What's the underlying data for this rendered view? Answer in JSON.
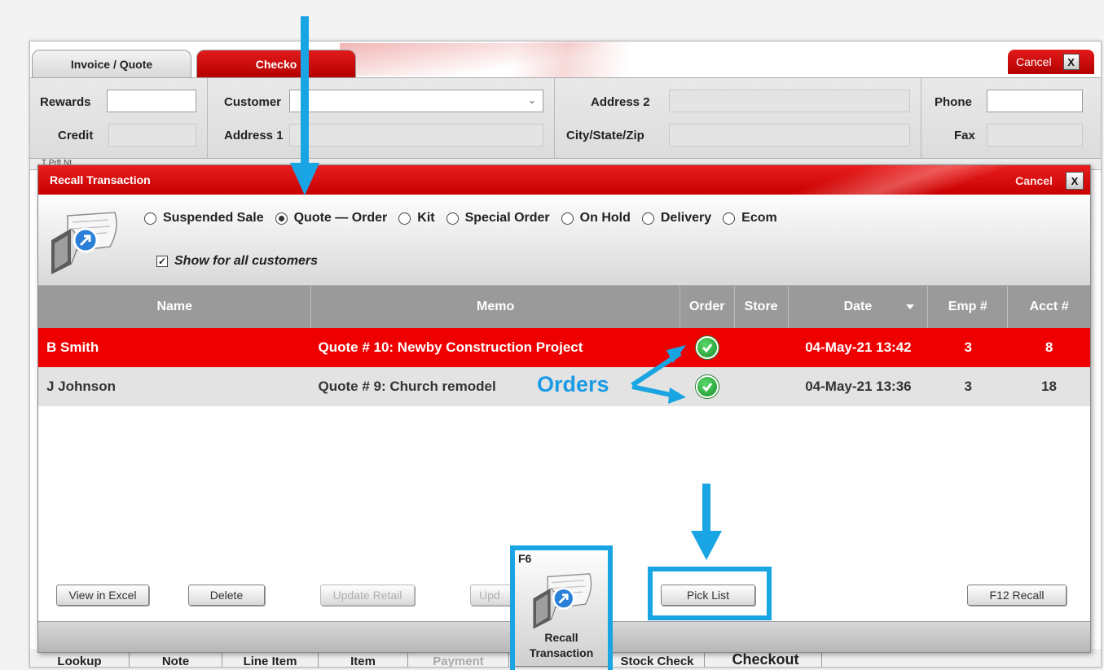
{
  "tabs": {
    "invoice_quote": "Invoice / Quote",
    "checkout": "Checko"
  },
  "window": {
    "cancel_label": "Cancel",
    "close_symbol": "X"
  },
  "header": {
    "rewards_label": "Rewards",
    "credit_label": "Credit",
    "customer_label": "Customer",
    "address1_label": "Address 1",
    "address2_label": "Address 2",
    "city_state_zip_label": "City/State/Zip",
    "phone_label": "Phone",
    "fax_label": "Fax",
    "under_strip_text": "T    Prft Nt"
  },
  "dialog": {
    "title": "Recall Transaction",
    "cancel_label": "Cancel",
    "close_symbol": "X",
    "radio_options": [
      {
        "label": "Suspended Sale",
        "selected": false
      },
      {
        "label": "Quote — Order",
        "selected": true
      },
      {
        "label": "Kit",
        "selected": false
      },
      {
        "label": "Special Order",
        "selected": false
      },
      {
        "label": "On Hold",
        "selected": false
      },
      {
        "label": "Delivery",
        "selected": false
      },
      {
        "label": "Ecom",
        "selected": false
      }
    ],
    "show_all_label": "Show for all customers",
    "show_all_checked": true,
    "columns": [
      "Name",
      "Memo",
      "Order",
      "Store",
      "Date",
      "Emp #",
      "Acct #"
    ],
    "rows": [
      {
        "name": "B Smith",
        "memo": "Quote # 10: Newby Construction Project",
        "order": "check-icon",
        "store": "",
        "date": "04-May-21 13:42",
        "emp": "3",
        "acct": "8",
        "selected": true
      },
      {
        "name": "J Johnson",
        "memo": "Quote # 9: Church remodel",
        "order": "check-icon",
        "store": "",
        "date": "04-May-21 13:36",
        "emp": "3",
        "acct": "18",
        "selected": false
      }
    ],
    "buttons": {
      "view_in_excel": "View in Excel",
      "delete": "Delete",
      "update_retail": "Update Retail",
      "update2": "Upd",
      "pick_list": "Pick List",
      "f12_recall": "F12 Recall"
    }
  },
  "annotation": {
    "orders": "Orders"
  },
  "f6_tile": {
    "key": "F6",
    "line1": "Recall",
    "line2": "Transaction"
  },
  "bottom_toolbar": [
    "Lookup",
    "Note",
    "Line Item",
    "Item",
    "Payment",
    "Stock Check",
    "Checkout"
  ],
  "colors": {
    "accent_red": "#e60000",
    "annotation_blue": "#19a5e3",
    "header_gray": "#9a9a9a"
  }
}
